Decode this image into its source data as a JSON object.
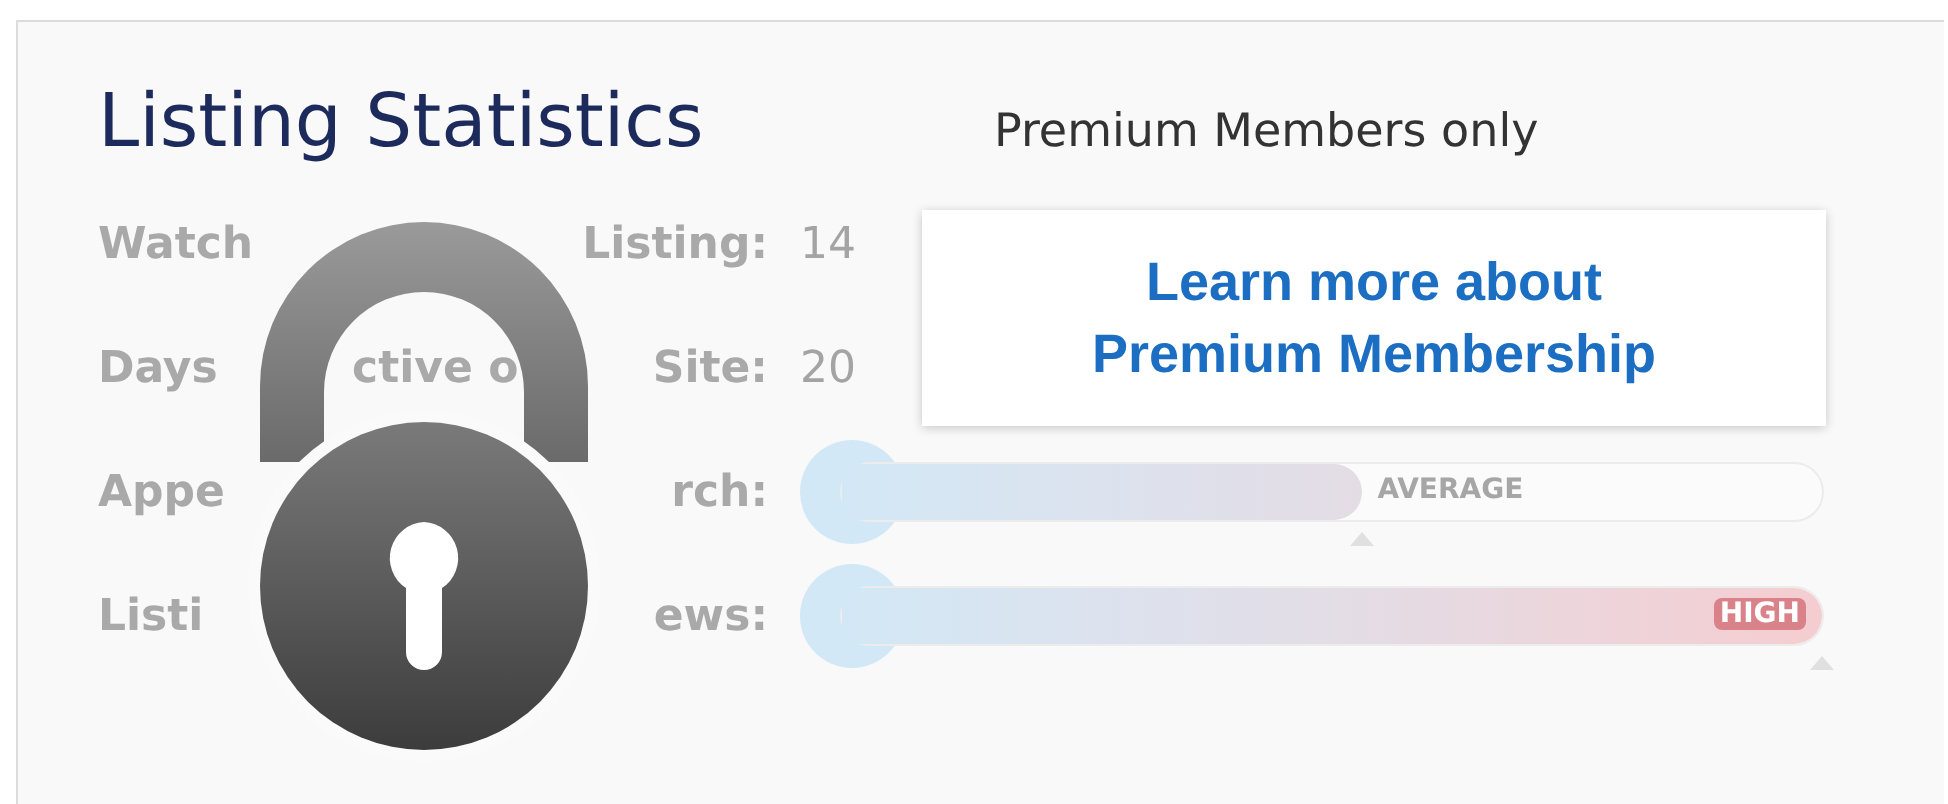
{
  "title": "Listing Statistics",
  "notice": "Premium Members only",
  "promo": "Learn more about Premium Membership",
  "stats": [
    {
      "kind": "number",
      "fragments": [
        "Watch",
        "Listing:"
      ],
      "value": "14"
    },
    {
      "kind": "number",
      "fragments": [
        "Days",
        "ctive o",
        "Site:"
      ],
      "value": "20"
    },
    {
      "kind": "meter",
      "fragments": [
        "Appe",
        "rch:"
      ],
      "level": 0.53,
      "reading": "AVERAGE"
    },
    {
      "kind": "meter",
      "fragments": [
        "Listi",
        "ews:"
      ],
      "level": 1,
      "reading": "HIGH"
    }
  ],
  "locked": true
}
